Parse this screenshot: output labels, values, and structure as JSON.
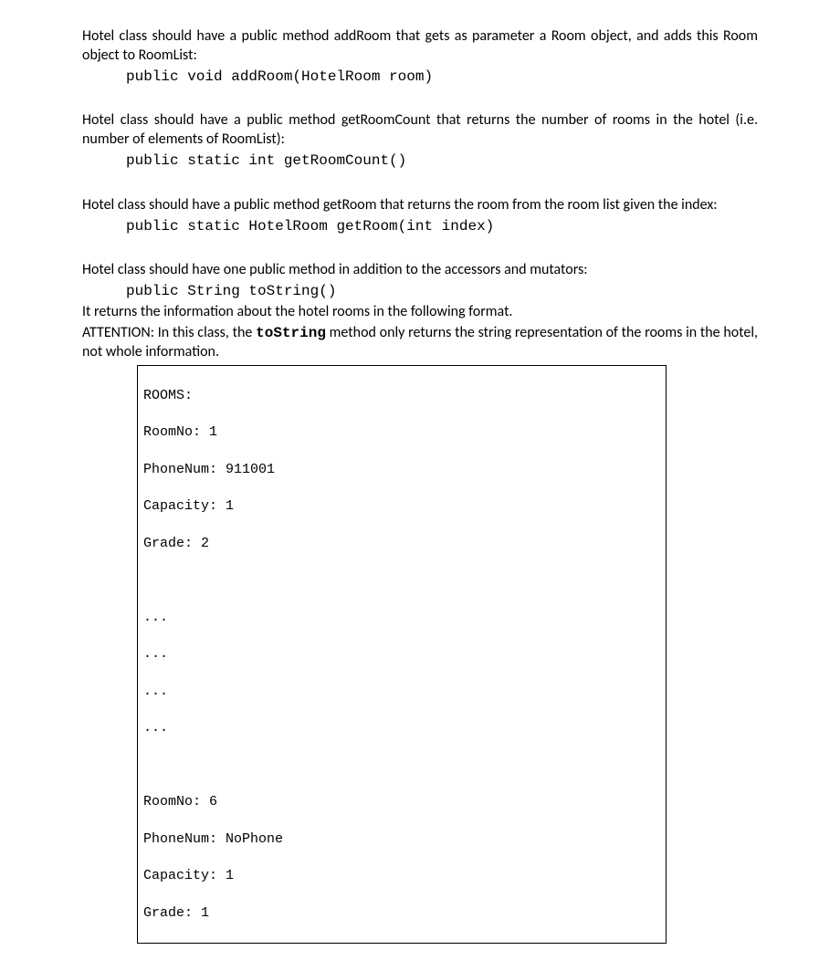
{
  "section1": {
    "text": "Hotel class should have a public method addRoom that gets as parameter a Room object, and adds this Room object to RoomList:",
    "code": "public void addRoom(HotelRoom room)"
  },
  "section2": {
    "text": "Hotel class should have a public method getRoomCount that returns the number of rooms in the hotel (i.e. number of elements of RoomList):",
    "code": "public static int getRoomCount()"
  },
  "section3": {
    "text": "Hotel class should have a public method getRoom  that returns the room from the room list given the index:",
    "code": "public static HotelRoom getRoom(int index)"
  },
  "section4": {
    "text1": "Hotel class should have one public method in addition to the accessors and mutators:",
    "code": "public String toString()",
    "text2": "It returns the information about the hotel rooms in the following format.",
    "attention_prefix": "ATTENTION: In this class, the ",
    "attention_bold": "toString",
    "attention_suffix": " method only returns the string representation of the rooms in the hotel, not whole information."
  },
  "output": {
    "lines": [
      "ROOMS:",
      "RoomNo: 1",
      "PhoneNum: 911001",
      "Capacity: 1",
      "Grade: 2",
      "",
      "...",
      "...",
      "...",
      "...",
      "",
      "RoomNo: 6",
      "PhoneNum: NoPhone",
      "Capacity: 1",
      "Grade: 1"
    ]
  }
}
